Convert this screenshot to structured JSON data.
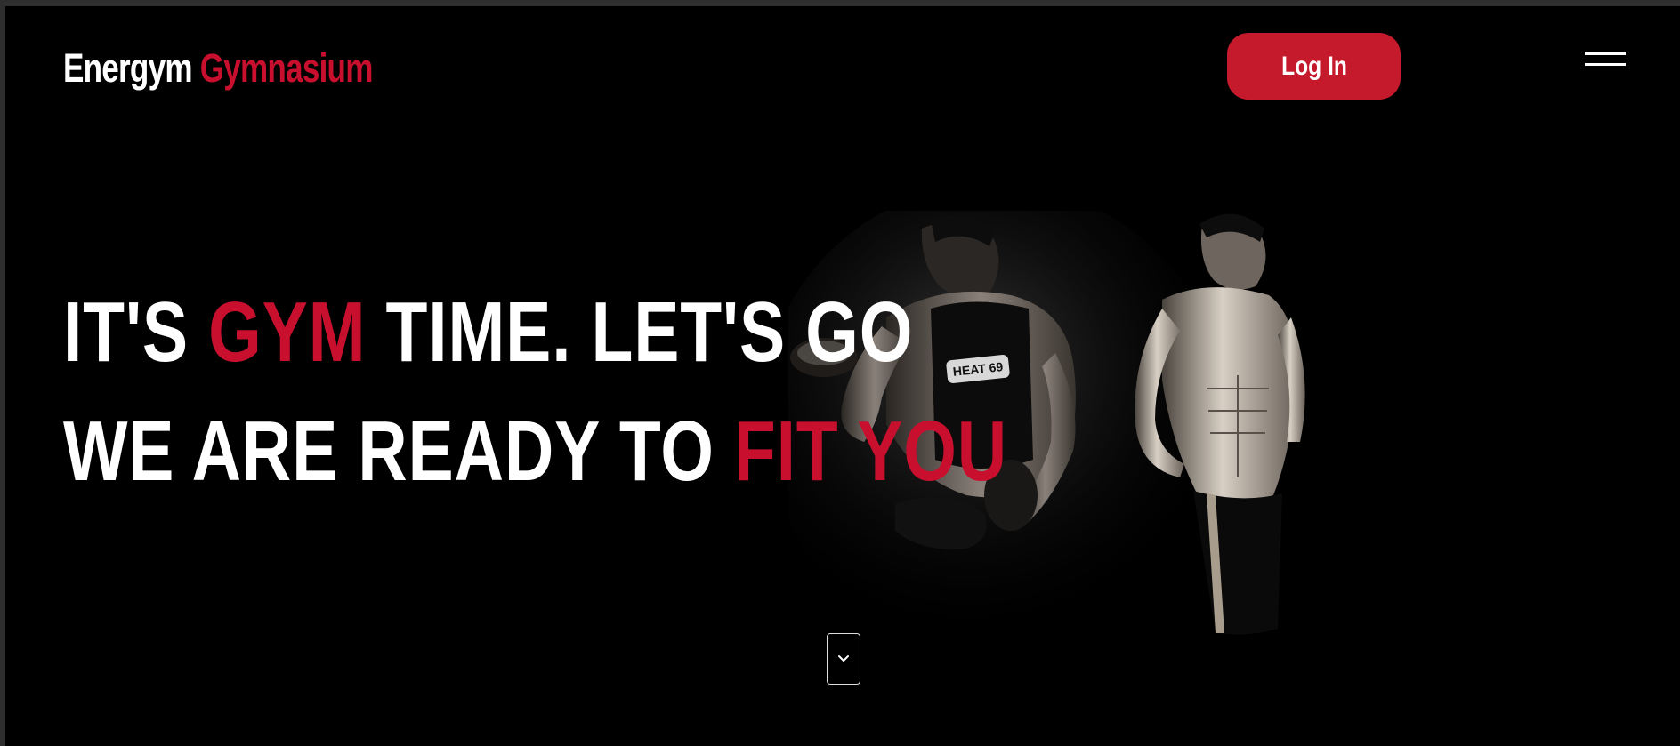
{
  "brand": {
    "first": "Energym",
    "second": "Gymnasium"
  },
  "header": {
    "login_label": "Log In",
    "menu_icon": "hamburger-menu-icon"
  },
  "hero": {
    "line1": {
      "before": "IT'S ",
      "highlight": "GYM",
      "after": " TIME. LET'S GO"
    },
    "line2": {
      "before": "WE ARE READY TO ",
      "highlight": "FIT YOU"
    },
    "image": "two-athletes-photo",
    "scroll_icon": "chevron-down-icon"
  },
  "colors": {
    "accent": "#c8102e",
    "button": "#c41a2c",
    "background": "#000000",
    "text": "#ffffff"
  }
}
